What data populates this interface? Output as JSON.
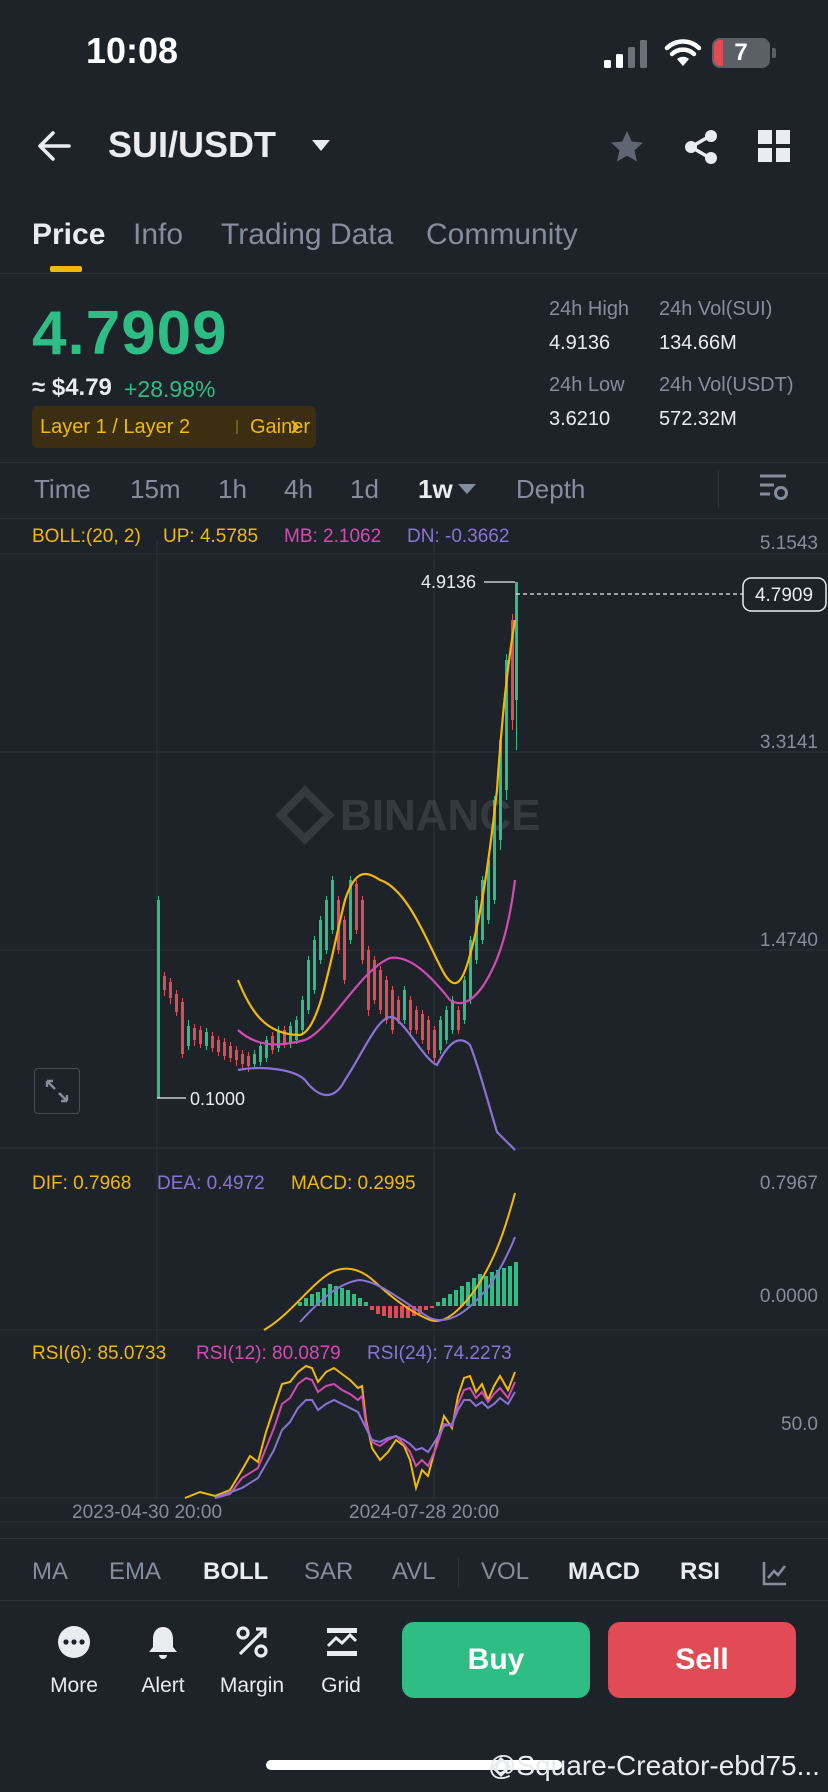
{
  "status": {
    "time": "10:08",
    "battery": "7"
  },
  "header": {
    "pair": "SUI/USDT"
  },
  "tabs": [
    {
      "label": "Price",
      "active": true
    },
    {
      "label": "Info"
    },
    {
      "label": "Trading Data"
    },
    {
      "label": "Community"
    }
  ],
  "price": {
    "last": "4.7909",
    "fiat": "≈ $4.79",
    "change": "+28.98%",
    "tags": [
      "Layer 1 / Layer 2",
      "Gainer"
    ]
  },
  "stats": {
    "high_label": "24h High",
    "high_value": "4.9136",
    "low_label": "24h Low",
    "low_value": "3.6210",
    "vol_base_label": "24h Vol(SUI)",
    "vol_base_value": "134.66M",
    "vol_quote_label": "24h Vol(USDT)",
    "vol_quote_value": "572.32M"
  },
  "intervals": [
    "Time",
    "15m",
    "1h",
    "4h",
    "1d",
    "1w",
    "Depth"
  ],
  "selected_interval": "1w",
  "boll": {
    "label": "BOLL:(20, 2)",
    "up": "UP: 4.5785",
    "mb": "MB: 2.1062",
    "dn": "DN: -0.3662"
  },
  "macd": {
    "dif": "DIF: 0.7968",
    "dea": "DEA: 0.4972",
    "macd": "MACD: 0.2995"
  },
  "rsi": {
    "rsi6": "RSI(6): 85.0733",
    "rsi12": "RSI(12): 80.0879",
    "rsi24": "RSI(24): 74.2273"
  },
  "axis": {
    "main": [
      "5.1543",
      "3.3141",
      "1.4740"
    ],
    "macd": [
      "0.7967",
      "0.0000"
    ],
    "rsi": [
      "50.0"
    ],
    "dates": [
      "2023-04-30 20:00",
      "2024-07-28 20:00"
    ]
  },
  "chart_labels": {
    "high": "4.9136",
    "low": "0.1000",
    "current": "4.7909",
    "watermark": "BINANCE"
  },
  "indicators": [
    {
      "label": "MA",
      "on": false
    },
    {
      "label": "EMA",
      "on": false
    },
    {
      "label": "BOLL",
      "on": true
    },
    {
      "label": "SAR",
      "on": false
    },
    {
      "label": "AVL",
      "on": false
    },
    {
      "label": "VOL",
      "on": false
    },
    {
      "label": "MACD",
      "on": true
    },
    {
      "label": "RSI",
      "on": true
    }
  ],
  "bottom": {
    "more": "More",
    "alert": "Alert",
    "margin": "Margin",
    "grid": "Grid",
    "buy": "Buy",
    "sell": "Sell"
  },
  "footer_watermark": "@Square-Creator-ebd75...",
  "colors": {
    "up": "#2ebd85",
    "down": "#e14b56",
    "accent": "#f0b90b",
    "boll_mb": "#d24bb2",
    "boll_dn": "#8a73d6"
  },
  "chart_data": {
    "type": "candlestick",
    "period": "1w",
    "x": [
      "2023-04-30 20:00",
      "2024-07-28 20:00"
    ],
    "y_axis": [
      1.474,
      3.3141,
      5.1543
    ],
    "high": 4.9136,
    "low": 0.1,
    "last": 4.7909
  }
}
